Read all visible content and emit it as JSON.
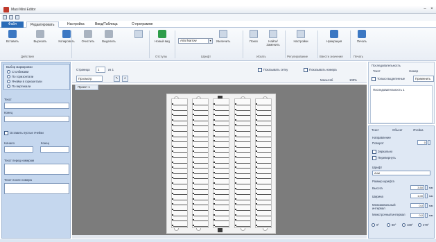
{
  "window": {
    "title": "Maxi Mini Editor"
  },
  "tabs": [
    "Файл",
    "Редактировать",
    "Настройка",
    "Ввод/Таблица",
    "О программе"
  ],
  "ribbon": {
    "buttons": [
      "Вставить",
      "Вырезать",
      "Копировать",
      "Очистить",
      "Выделить",
      "Новый вид",
      "Увеличить",
      "Поиск",
      "Найти/Заменить",
      "Настройки",
      "Нумерация",
      "Печать"
    ],
    "groups": [
      "Действия",
      "Отступы",
      "Шрифт",
      "Искать",
      "Регулирование",
      "Ввести значения",
      "Печать"
    ],
    "font_value": "Arial Narrow"
  },
  "left_panel": {
    "options_label": "Выбор маркировки",
    "radios": [
      "Столбиками",
      "По горизонтали",
      "Ячейки в горизонтали",
      "По вертикали"
    ],
    "label_text": "Текст",
    "label_end": "Конец",
    "check_blank": "Оставить пустые ячейки",
    "from_label": "Начало",
    "to_label": "Конец",
    "prefix_label": "Текст перед номером",
    "suffix_label": "Текст после номера"
  },
  "editor": {
    "page_label": "Страница",
    "page_value": "1",
    "page_of": "из 1",
    "preview_label": "Просмотр",
    "check_grid": "Показывать сетку",
    "check_numbers": "Показывать номера",
    "zoom_label": "Масштаб",
    "zoom_value": "100%",
    "doc_tab": "Проект 1"
  },
  "right_top": {
    "title": "Последовательность",
    "row1_a": "Текст",
    "row1_b": "Номер",
    "check_all": "Только выделенные",
    "button": "Применить",
    "tree_item": "Последовательность 1"
  },
  "right_bottom": {
    "tabs": [
      "Текст",
      "Объект",
      "Ячейка"
    ],
    "section1": "Направление",
    "rotate_label": "Поворот",
    "rotate_value": "0",
    "check1": "Зеркально",
    "check2": "Перевернуть",
    "font_label": "Шрифт",
    "font_value": "Arial",
    "size_section": "Размер шрифта",
    "height_label": "Высота",
    "height_value": "3,50",
    "width_label": "Ширина",
    "width_value": "1,00",
    "spacing_label": "Межсимвольный интервал",
    "spacing_value": "0,0",
    "line_label": "Межстрочный интервал",
    "line_value": "0,0",
    "unit": "мм",
    "angles": [
      "0°",
      "90°",
      "180°",
      "270°"
    ]
  }
}
